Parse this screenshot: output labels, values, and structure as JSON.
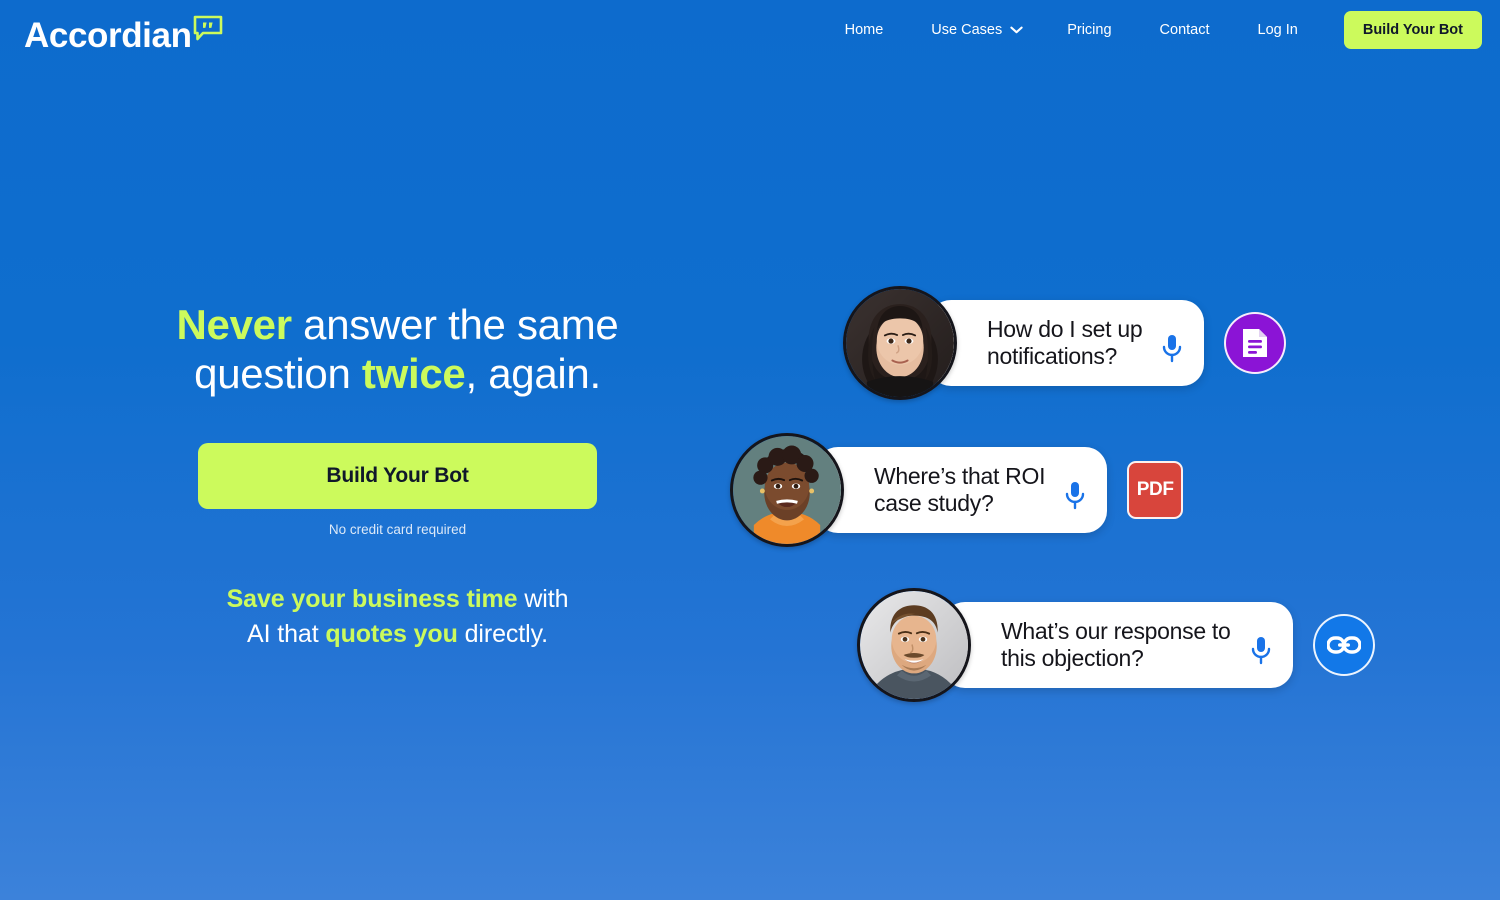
{
  "brand": {
    "name": "Accordian",
    "mark_icon": "speech-bubble-quote-icon",
    "mark_color": "#ccfa5c"
  },
  "nav": {
    "items": [
      {
        "label": "Home",
        "has_dropdown": false
      },
      {
        "label": "Use Cases",
        "has_dropdown": true,
        "caret_icon": "chevron-down-icon"
      },
      {
        "label": "Pricing",
        "has_dropdown": false
      },
      {
        "label": "Contact",
        "has_dropdown": false
      },
      {
        "label": "Log In",
        "has_dropdown": false
      }
    ],
    "cta_label": "Build Your Bot"
  },
  "hero": {
    "headline": {
      "line1_pre": "Never",
      "line1_rest": " answer the same",
      "line2_pre": "question ",
      "line2_hl": "twice",
      "line2_post": ", again."
    },
    "cta_label": "Build Your Bot",
    "cta_note": "No credit card required",
    "subhead": {
      "line1_hl": "Save your business time",
      "line1_rest": " with",
      "line2_pre": "AI that ",
      "line2_hl": "quotes you",
      "line2_post": " directly."
    }
  },
  "chat_examples": [
    {
      "avatar_alt": "woman-dark-hair-avatar",
      "message": "How do I set up\nnotifications?",
      "mic_icon": "microphone-icon",
      "badge_type": "document",
      "badge_icon": "document-icon",
      "badge_color": "#8b14d6"
    },
    {
      "avatar_alt": "woman-curly-hair-orange-top-avatar",
      "message": "Where’s that ROI\ncase study?",
      "mic_icon": "microphone-icon",
      "badge_type": "pdf",
      "badge_icon": "pdf-file-icon",
      "badge_label": "PDF",
      "badge_color": "#d8453c"
    },
    {
      "avatar_alt": "man-short-hair-avatar",
      "message": "What’s our response to\nthis objection?",
      "mic_icon": "microphone-icon",
      "badge_type": "link",
      "badge_icon": "link-chain-icon",
      "badge_color": "#1278e8"
    }
  ],
  "theme": {
    "background_top": "#0d6bcd",
    "background_bottom": "#3c82da",
    "accent_lime": "#ccfa5c",
    "text_on_accent": "#10182a",
    "bubble_bg": "#ffffff",
    "mic_blue": "#1a73e8"
  }
}
